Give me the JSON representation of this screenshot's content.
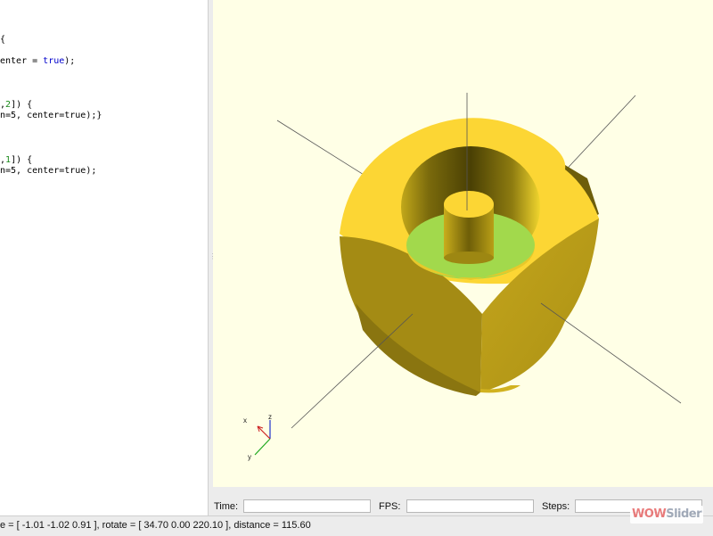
{
  "editor": {
    "lines": [
      {
        "segments": [
          {
            "text": "{",
            "cls": ""
          }
        ]
      },
      {
        "segments": [
          {
            "text": "enter = ",
            "cls": ""
          },
          {
            "text": "true",
            "cls": "kw"
          },
          {
            "text": ");",
            "cls": ""
          }
        ]
      },
      {
        "segments": [
          {
            "text": ",",
            "cls": ""
          },
          {
            "text": "2",
            "cls": "num"
          },
          {
            "text": "]) {",
            "cls": ""
          }
        ]
      },
      {
        "segments": [
          {
            "text": "n=5, center=true);}",
            "cls": ""
          }
        ]
      },
      {
        "segments": [
          {
            "text": ",",
            "cls": ""
          },
          {
            "text": "1",
            "cls": "num"
          },
          {
            "text": "]) {",
            "cls": ""
          }
        ]
      },
      {
        "segments": [
          {
            "text": "n=5, center=true);",
            "cls": ""
          }
        ]
      }
    ]
  },
  "readout": {
    "time_label": "Time:",
    "fps_label": "FPS:",
    "steps_label": "Steps:"
  },
  "axis_labels": {
    "x": "x",
    "y": "y",
    "z": "z"
  },
  "status": {
    "text": "e = [ -1.01 -1.02 0.91 ], rotate = [ 34.70 0.00 220.10 ], distance = 115.60"
  },
  "watermark": {
    "part1": "WOW",
    "part2": "Slider"
  },
  "colors": {
    "viewport_bg": "#ffffe6",
    "model_top": "#fcd634",
    "model_side": "#ad9414",
    "inner_green": "#a2d94c"
  }
}
